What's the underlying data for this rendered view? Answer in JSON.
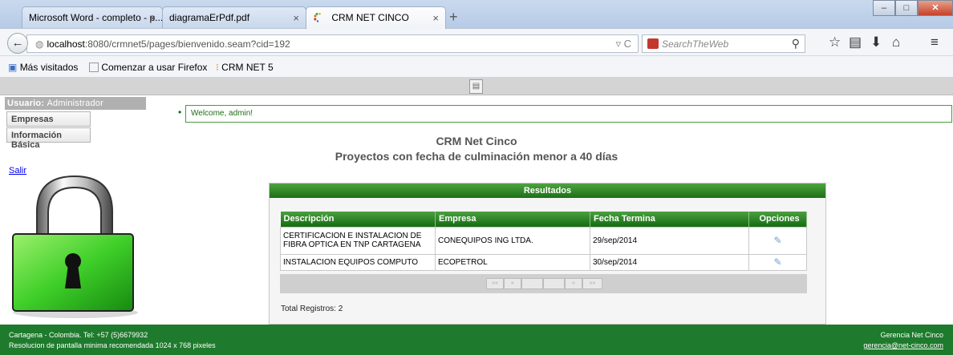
{
  "browser": {
    "tabs": [
      {
        "label": "Microsoft Word - completo - p...",
        "close": "×"
      },
      {
        "label": "diagramaErPdf.pdf",
        "close": "×"
      },
      {
        "label": "CRM NET CINCO",
        "close": "×"
      }
    ],
    "new_tab": "+",
    "url_host": "localhost",
    "url_rest": ":8080/crmnet5/pages/bienvenido.seam?cid=192",
    "search_placeholder": "SearchTheWeb",
    "bookmarks": [
      "Más visitados",
      "Comenzar a usar Firefox",
      "CRM NET 5"
    ]
  },
  "sidebar": {
    "user_label": "Usuario:",
    "user_name": "Administrador",
    "items": [
      "Empresas",
      "Información Básica"
    ],
    "logout": "Salir"
  },
  "main": {
    "welcome": "Welcome, admin!",
    "title": "CRM Net Cinco",
    "subtitle": "Proyectos con fecha de culminación menor a 40 días",
    "panel_title": "Resultados",
    "columns": [
      "Descripción",
      "Empresa",
      "Fecha Termina",
      "Opciones"
    ],
    "rows": [
      {
        "descripcion": "CERTIFICACION E INSTALACION DE FIBRA OPTICA EN TNP CARTAGENA",
        "empresa": "CONEQUIPOS ING LTDA.",
        "fecha": "29/sep/2014"
      },
      {
        "descripcion": "INSTALACION EQUIPOS COMPUTO",
        "empresa": "ECOPETROL",
        "fecha": "30/sep/2014"
      }
    ],
    "pager": [
      "««",
      "«",
      "",
      "",
      "»",
      "»»"
    ],
    "total": "Total Registros: 2"
  },
  "footer": {
    "left_line1": "Cartagena - Colombia. Tel: +57 (5)6679932",
    "left_line2": "Resolucion de pantalla minima recomendada 1024 x 768 pixeles",
    "right_line1": "Gerencia Net Cinco",
    "right_line2": "gerencia@net-cinco.com"
  }
}
